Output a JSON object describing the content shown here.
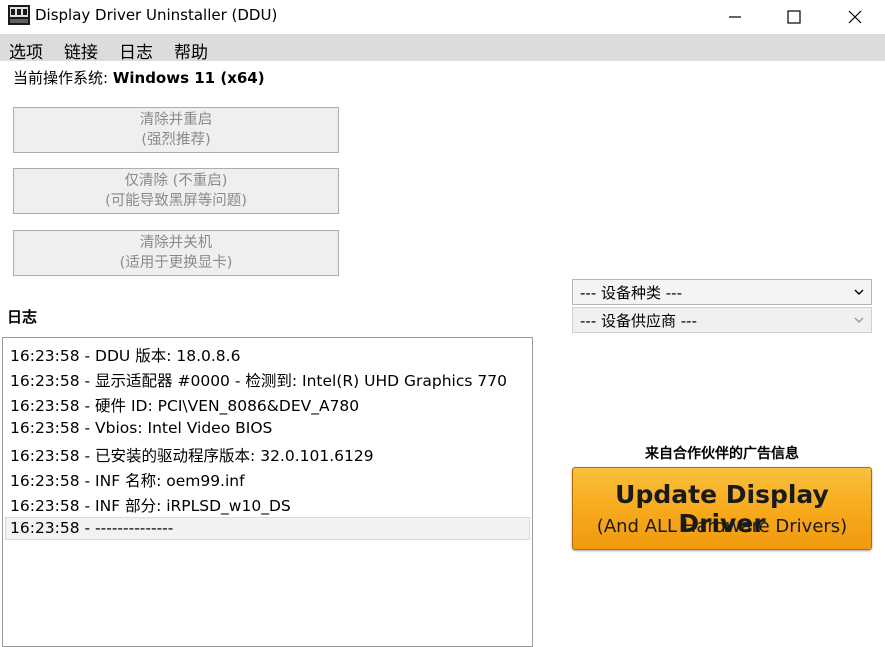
{
  "window": {
    "title": "Display Driver Uninstaller (DDU)",
    "icon_name": "ddu-app-icon"
  },
  "menu": {
    "items": [
      "选项",
      "链接",
      "日志",
      "帮助"
    ]
  },
  "os": {
    "label": "当前操作系统: ",
    "value": "Windows 11 (x64)"
  },
  "actions": [
    {
      "line1": "清除并重启",
      "line2": "(强烈推荐)"
    },
    {
      "line1": "仅清除 (不重启)",
      "line2": "(可能导致黑屏等问题)"
    },
    {
      "line1": "清除并关机",
      "line2": "(适用于更换显卡)"
    }
  ],
  "log": {
    "heading": "日志",
    "lines": [
      "16:23:58 - DDU 版本: 18.0.8.6",
      "16:23:58 - 显示适配器 #0000 - 检测到: Intel(R) UHD Graphics 770",
      "16:23:58 - 硬件 ID: PCI\\VEN_8086&DEV_A780",
      "16:23:58 - Vbios: Intel Video BIOS",
      "16:23:58 - 已安装的驱动程序版本: 32.0.101.6129",
      "16:23:58 - INF 名称: oem99.inf",
      "16:23:58 - INF 部分: iRPLSD_w10_DS",
      "16:23:58 - --------------"
    ]
  },
  "device_type": {
    "value": "--- 设备种类 ---"
  },
  "device_vendor": {
    "value": "--- 设备供应商 ---"
  },
  "ad": {
    "caption": "来自合作伙伴的广告信息",
    "title": "Update Display Driver",
    "subtitle": "(And ALL Hardware Drivers)"
  },
  "colors": {
    "menubar": "#dcdcdc",
    "ad_orange": "#f7a81b",
    "disabled_text": "#8a8a8a"
  }
}
